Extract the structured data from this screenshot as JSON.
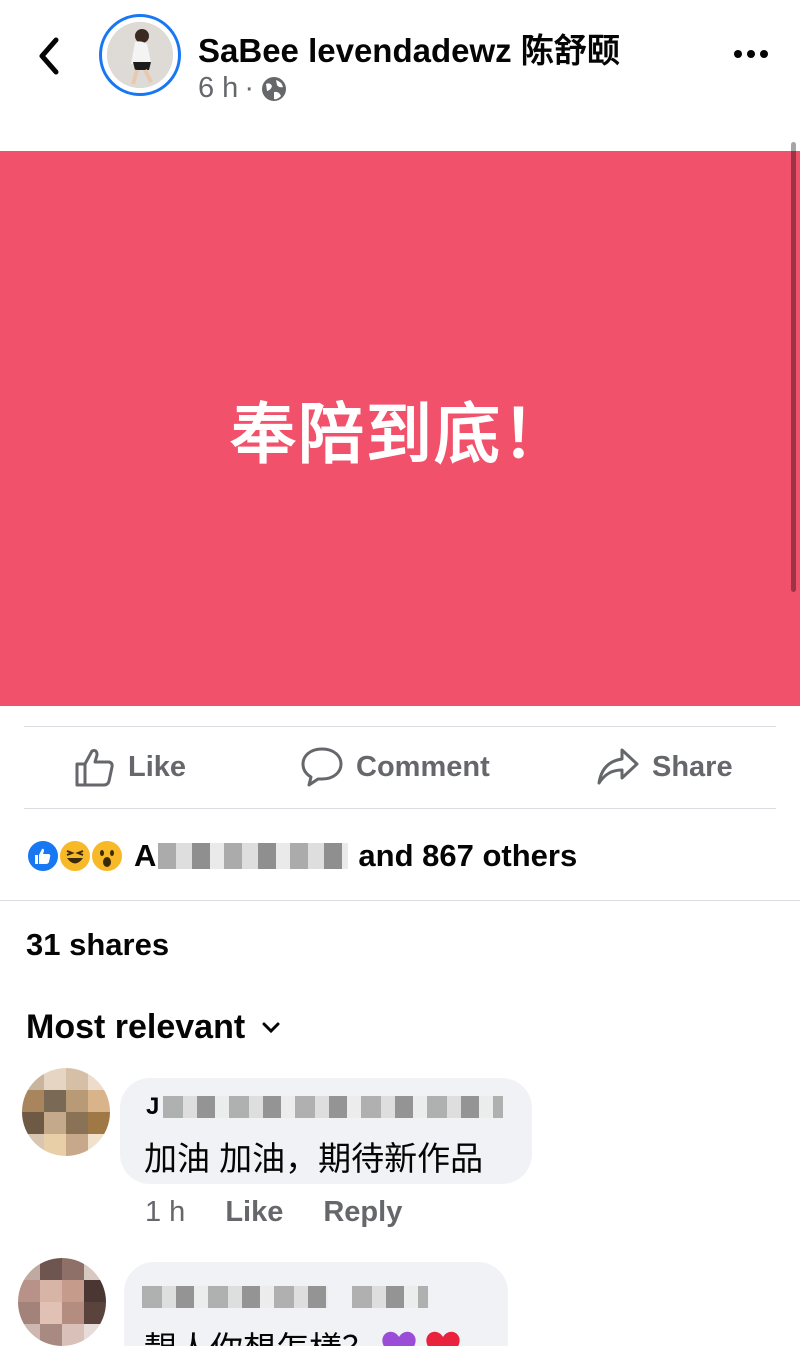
{
  "header": {
    "author": "SaBee levendadewz 陈舒颐",
    "time": "6 h",
    "separator": "·"
  },
  "post": {
    "text": "奉陪到底！",
    "background": "#f1516a"
  },
  "actions": {
    "like": "Like",
    "comment": "Comment",
    "share": "Share"
  },
  "reactions": {
    "icons": [
      "like-icon",
      "haha-icon",
      "wow-icon"
    ],
    "name_initial": "A",
    "others": "and 867 others"
  },
  "shares": "31 shares",
  "sort": {
    "label": "Most relevant"
  },
  "comments": [
    {
      "name_initial": "J",
      "text": "加油 加油，期待新作品",
      "time": "1 h",
      "like": "Like",
      "reply": "Reply"
    },
    {
      "text": "靚人你想怎樣？"
    }
  ],
  "colors": {
    "accent": "#1877f2",
    "secondary_text": "#65676b"
  }
}
